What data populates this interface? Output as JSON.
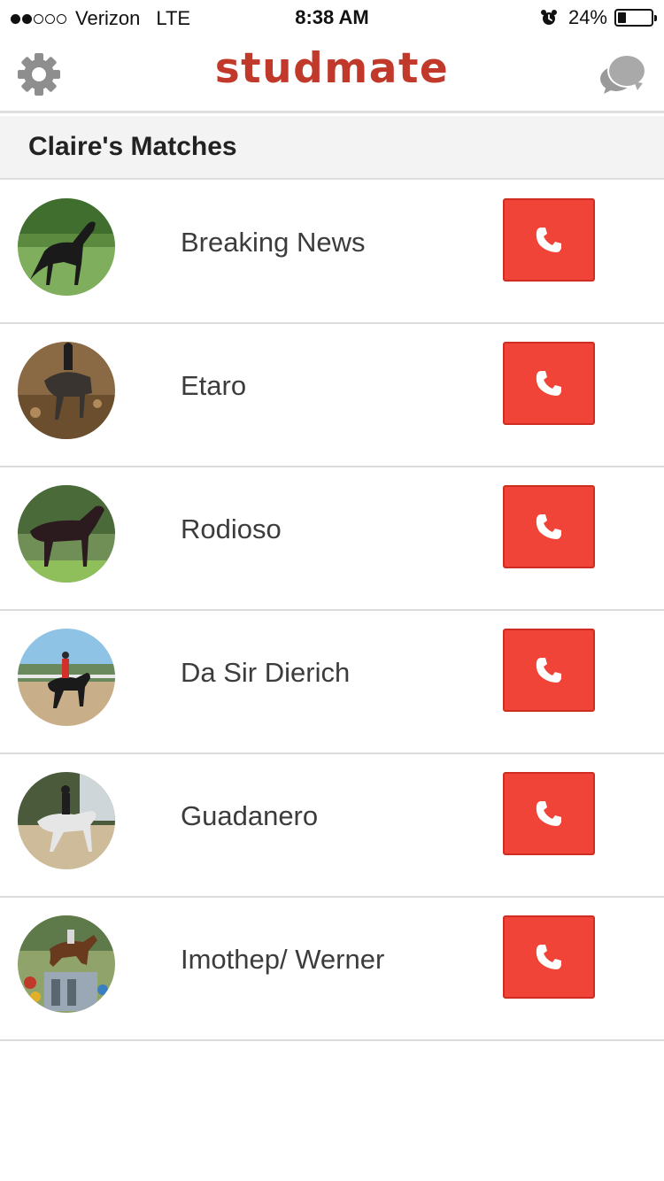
{
  "status_bar": {
    "signal_bars_filled": 2,
    "signal_bars_total": 5,
    "carrier": "Verizon",
    "network": "LTE",
    "time": "8:38 AM",
    "alarm_icon": "alarm-clock-icon",
    "battery_percent_text": "24%",
    "battery_level": 0.24
  },
  "nav": {
    "settings_icon": "gear-icon",
    "logo": "studmate",
    "chat_icon": "chat-bubbles-icon"
  },
  "colors": {
    "brand": "#c0392b",
    "call_button": "#ef4437",
    "section_bg": "#f3f3f3"
  },
  "section": {
    "title": "Claire's Matches"
  },
  "matches": [
    {
      "name": "Breaking News",
      "call_icon": "phone-icon"
    },
    {
      "name": "Etaro",
      "call_icon": "phone-icon"
    },
    {
      "name": "Rodioso",
      "call_icon": "phone-icon"
    },
    {
      "name": "Da Sir Dierich",
      "call_icon": "phone-icon"
    },
    {
      "name": "Guadanero",
      "call_icon": "phone-icon"
    },
    {
      "name": "Imothep/ Werner",
      "call_icon": "phone-icon"
    }
  ]
}
